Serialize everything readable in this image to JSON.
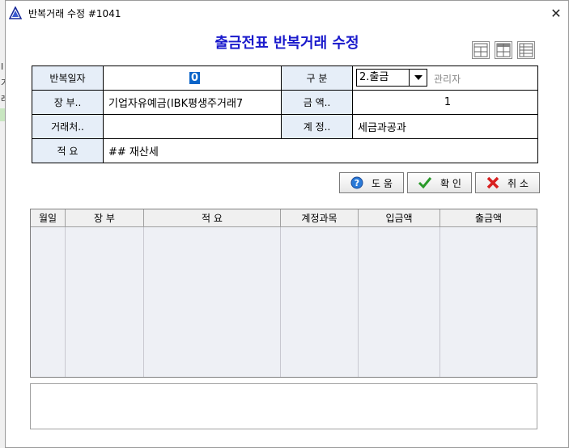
{
  "window": {
    "title": "반복거래 수정 #1041",
    "close_label": "✕"
  },
  "heading": "출금전표 반복거래 수정",
  "form": {
    "repeat_day_label": "반복일자",
    "repeat_day_value": "0",
    "gubun_label": "구 분",
    "gubun_value": "2.출금",
    "admin_label": "관리자",
    "ledger_label": "장 부..",
    "ledger_value": "기업자유예금(IBK평생주거래7",
    "amount_label": "금 액..",
    "amount_value": "1",
    "client_label": "거래처..",
    "client_value": "",
    "account_label": "계 정..",
    "account_value": "세금과공과",
    "memo_label": "적 요",
    "memo_value": "## 재산세"
  },
  "buttons": {
    "help": "도 움",
    "ok": "확 인",
    "cancel": "취 소"
  },
  "grid": {
    "columns": [
      "월일",
      "장 부",
      "적 요",
      "계정과목",
      "입금액",
      "출금액"
    ]
  },
  "bg_app": {
    "texts": [
      "I",
      "가",
      "레"
    ]
  }
}
